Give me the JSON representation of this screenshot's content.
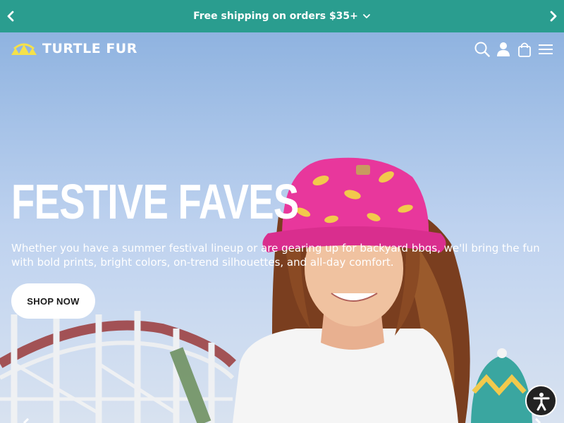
{
  "announcement": {
    "text": "Free shipping on orders $35+",
    "prev_icon": "chevron-left-icon",
    "next_icon": "chevron-right-icon",
    "dropdown_icon": "chevron-down-icon",
    "bg_color": "#2a9d8f"
  },
  "header": {
    "brand": "TURTLE FUR",
    "logo_icon": "turtle-shell-icon",
    "logo_color": "#f5e14a",
    "icons": [
      "search-icon",
      "account-icon",
      "cart-icon",
      "menu-icon"
    ]
  },
  "hero": {
    "title": "FESTIVE FAVES",
    "description": "Whether you have a summer festival lineup or are gearing up for backyard bbqs, we'll bring the fun with bold prints, bright colors, on-trend silhouettes, and all-day comfort.",
    "cta_label": "SHOP NOW"
  },
  "accessibility": {
    "icon": "accessibility-icon"
  }
}
